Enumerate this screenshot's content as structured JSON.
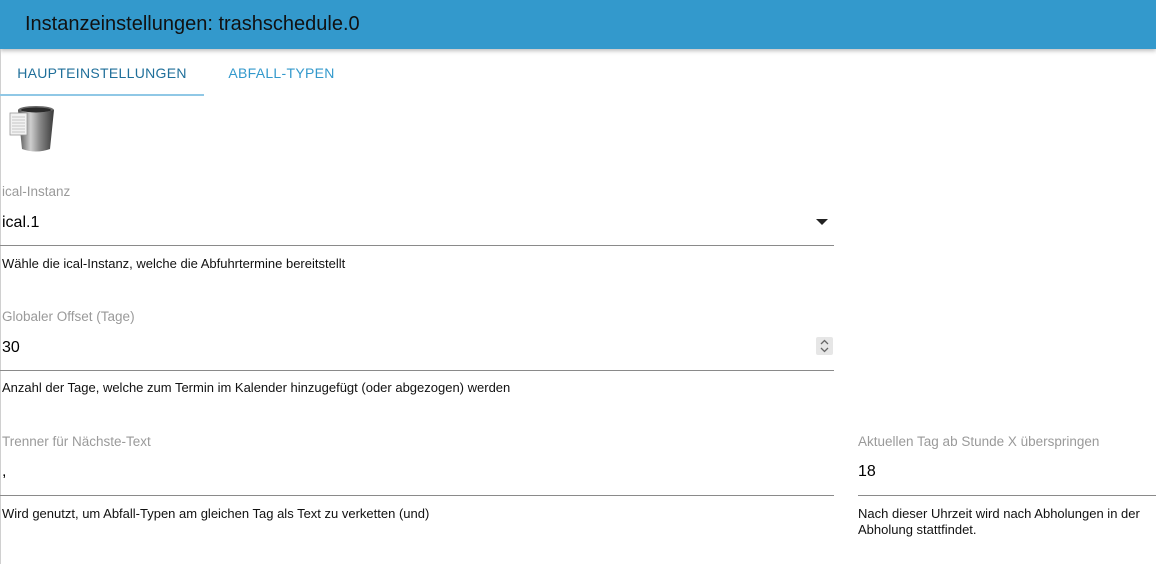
{
  "header": {
    "title": "Instanzeinstellungen: trashschedule.0"
  },
  "tabs": [
    {
      "label": "HAUPTEINSTELLUNGEN",
      "active": true
    },
    {
      "label": "ABFALL-TYPEN",
      "active": false
    }
  ],
  "colors": {
    "header": "#3399cc",
    "tab_text": "#3399cc",
    "tab_underline": "#90c8e6"
  },
  "fields": {
    "ical": {
      "label": "ical-Instanz",
      "value": "ical.1",
      "help": "Wähle die ical-Instanz, welche die Abfuhrtermine bereitstellt"
    },
    "offset": {
      "label": "Globaler Offset (Tage)",
      "value": "30",
      "help": "Anzahl der Tage, welche zum Termin im Kalender hinzugefügt (oder abgezogen) werden"
    },
    "separator": {
      "label": "Trenner für Nächste-Text",
      "value": ",",
      "help": "Wird genutzt, um Abfall-Typen am gleichen Tag als Text zu verketten (und)"
    },
    "skip_hour": {
      "label": "Aktuellen Tag ab Stunde X überspringen",
      "value": "18",
      "help_line1": "Nach dieser Uhrzeit wird nach Abholungen in der",
      "help_line2": "Abholung stattfindet."
    }
  }
}
